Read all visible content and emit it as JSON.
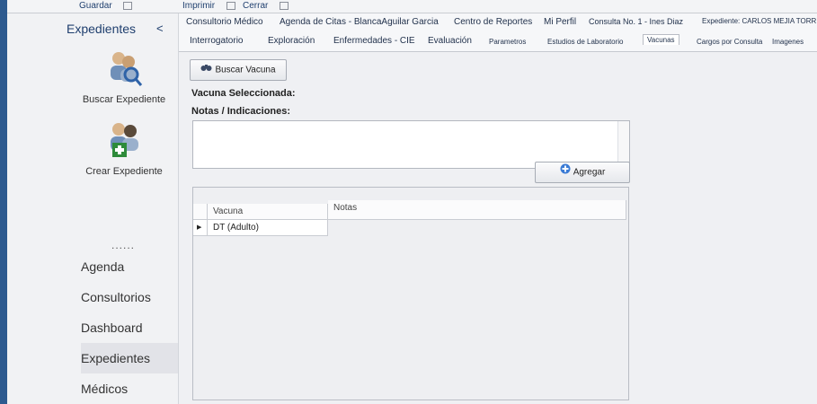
{
  "toolbar": {
    "save_label": "Guardar",
    "print_label": "Imprimir",
    "close_label": "Cerrar"
  },
  "sidebar": {
    "title": "Expedientes",
    "collapse_glyph": "<",
    "actions": [
      {
        "label": "Buscar Expediente",
        "icon": "search-patient-icon"
      },
      {
        "label": "Crear Expediente",
        "icon": "add-patient-icon"
      }
    ],
    "dots": "......",
    "nav": [
      {
        "label": "Agenda"
      },
      {
        "label": "Consultorios"
      },
      {
        "label": "Dashboard"
      },
      {
        "label": "Expedientes",
        "active": true
      },
      {
        "label": "Médicos"
      }
    ]
  },
  "main_tabs": [
    {
      "label": "Consultorio Médico"
    },
    {
      "label": "Agenda de Citas - BlancaAguilar Garcia"
    },
    {
      "label": "Centro de Reportes"
    },
    {
      "label": "Mi Perfil"
    },
    {
      "label": "Consulta No. 1 - Ines Diaz"
    },
    {
      "label": "Expediente: CARLOS MEJIA TORRE"
    }
  ],
  "sub_tabs": [
    {
      "label": "Interrogatorio"
    },
    {
      "label": "Exploración"
    },
    {
      "label": "Enfermedades - CIE"
    },
    {
      "label": "Evaluación"
    },
    {
      "label": "Parametros"
    },
    {
      "label": "Estudios de Laboratorio"
    },
    {
      "label": "Vacunas",
      "selected": true
    },
    {
      "label": "Cargos por Consulta"
    },
    {
      "label": "Imagenes"
    }
  ],
  "form": {
    "search_button": "Buscar Vacuna",
    "selected_label": "Vacuna Seleccionada:",
    "notes_label": "Notas / Indicaciones:",
    "notes_value": "",
    "add_button": "Agregar"
  },
  "table": {
    "columns": [
      "Vacuna",
      "Notas"
    ],
    "rows": [
      {
        "vacuna": "DT (Adulto)",
        "notas": ""
      }
    ]
  },
  "colors": {
    "accent": "#1f3f6e",
    "background": "#eff0f3"
  }
}
